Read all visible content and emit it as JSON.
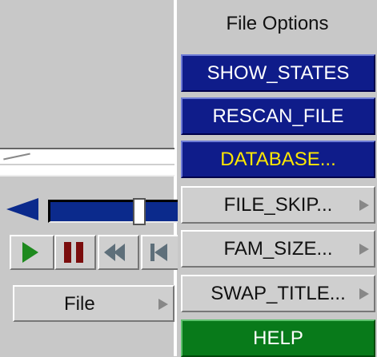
{
  "left_panel": {
    "file_button_label": "File"
  },
  "menu": {
    "title": "File Options",
    "items": [
      {
        "label": "SHOW_STATES",
        "style": "blue",
        "submenu": false
      },
      {
        "label": "RESCAN_FILE",
        "style": "blue",
        "submenu": false
      },
      {
        "label": "DATABASE...",
        "style": "blue-yellow",
        "submenu": false
      },
      {
        "label": "FILE_SKIP...",
        "style": "gray",
        "submenu": true
      },
      {
        "label": "FAM_SIZE...",
        "style": "gray",
        "submenu": true
      },
      {
        "label": "SWAP_TITLE...",
        "style": "gray",
        "submenu": true
      },
      {
        "label": "HELP",
        "style": "green",
        "submenu": false
      }
    ]
  },
  "colors": {
    "menu_blue": "#0f1c8a",
    "menu_green": "#087a1a",
    "menu_gray": "#cfcfcf",
    "highlight_text": "#ffe800",
    "play_green": "#1e8a1e",
    "pause_red": "#7b0d0d"
  },
  "icons": {
    "play": "play-icon",
    "pause": "pause-icon",
    "rewind": "rewind-icon",
    "step_back": "step-back-icon",
    "submenu": "submenu-arrow-icon",
    "slider_left": "slider-left-arrow-icon"
  }
}
